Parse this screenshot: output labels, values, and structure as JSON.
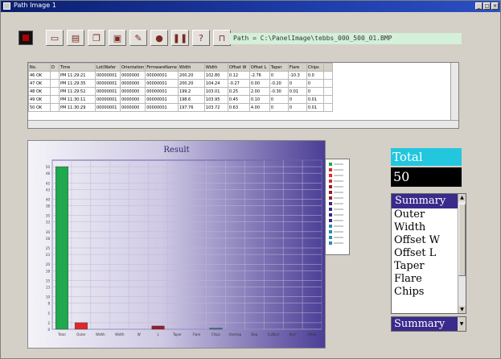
{
  "window": {
    "title": "Path Image 1",
    "controls": [
      "_",
      "□",
      "×"
    ]
  },
  "toolbar": {
    "buttons": [
      {
        "name": "new-file-button",
        "icon": "document-icon",
        "glyph": "▭"
      },
      {
        "name": "open-button",
        "icon": "open-file-icon",
        "glyph": "▤"
      },
      {
        "name": "copy-button",
        "icon": "copy-icon",
        "glyph": "❐"
      },
      {
        "name": "print-button",
        "icon": "print-icon",
        "glyph": "▣"
      },
      {
        "name": "edit-button",
        "icon": "pencil-icon",
        "glyph": "✎"
      },
      {
        "name": "record-button",
        "icon": "record-icon",
        "glyph": "●"
      },
      {
        "name": "pause-button",
        "icon": "pause-icon",
        "glyph": "❚❚"
      },
      {
        "name": "help-button",
        "icon": "help-icon",
        "glyph": "?"
      },
      {
        "name": "lock-button",
        "icon": "lock-icon",
        "glyph": "⊓"
      }
    ]
  },
  "path": {
    "text": "Path  =  C:\\PanelImage\\tebbs_000_500_01.BMP"
  },
  "grid": {
    "columns": [
      "No.",
      "D",
      "Time",
      "Lot/Wafer",
      "Orientation",
      "FirmwareName",
      "Width",
      "Width",
      "Offset W",
      "Offset L",
      "Taper",
      "Flare",
      "Chips",
      ""
    ],
    "rows": [
      {
        "no": "46 OK",
        "d": "",
        "time": "PM 11:29:21",
        "lot": "00000001",
        "ori": "0000000",
        "fw": "00000001",
        "a": "200.20",
        "b": "102.80",
        "c": "0.12",
        "d2": "-2.76",
        "e": "0",
        "f": "-10.3",
        "g": "0.0"
      },
      {
        "no": "47 OK",
        "d": "",
        "time": "PM 11:29:35",
        "lot": "00000001",
        "ori": "0000000",
        "fw": "00000001",
        "a": "200.20",
        "b": "104.24",
        "c": "-0.27",
        "d2": "0.00",
        "e": "-0.20",
        "f": "0",
        "g": "0"
      },
      {
        "no": "48 OK",
        "d": "",
        "time": "PM 11:29:52",
        "lot": "00000001",
        "ori": "0000000",
        "fw": "00000001",
        "a": "199.2",
        "b": "103.01",
        "c": "0.25",
        "d2": "2.00",
        "e": "-0.30",
        "f": "0.01",
        "g": "0"
      },
      {
        "no": "49 OK",
        "d": "",
        "time": "PM 11:30:11",
        "lot": "00000001",
        "ori": "0000000",
        "fw": "00000001",
        "a": "198.6",
        "b": "103.95",
        "c": "0.45",
        "d2": "0.10",
        "e": "0",
        "f": "0",
        "g": "0.01"
      },
      {
        "no": "50 OK",
        "d": "",
        "time": "PM 11:30:29",
        "lot": "00000001",
        "ori": "0000000",
        "fw": "00000001",
        "a": "197.76",
        "b": "103.72",
        "c": "0.63",
        "d2": "4.00",
        "e": "0",
        "f": "0",
        "g": "0.01"
      }
    ]
  },
  "chart_data": {
    "type": "bar",
    "title": "Result",
    "categories": [
      "Total",
      "Outer",
      "Width",
      "Width",
      "W",
      "L",
      "Taper",
      "Flare",
      "Chips",
      "Overlap",
      "Dep",
      "CutBurr",
      "Burr",
      "Other"
    ],
    "values": [
      50,
      2,
      0,
      0,
      0,
      1,
      0,
      0,
      0.3,
      0,
      0,
      0,
      0,
      0
    ],
    "bar_colors": [
      "#1fa84e",
      "#e0262d",
      "#e0262d",
      "#e0262d",
      "#e0262d",
      "#9b1b2a",
      "#9b1b2a",
      "#9b1b2a",
      "#1e7f8a",
      "#1e7f8a",
      "#1e7f8a",
      "#1e7f8a",
      "#1e7f8a",
      "#1e7f8a"
    ],
    "yticks": [
      0,
      2,
      5,
      8,
      10,
      13,
      15,
      18,
      20,
      23,
      25,
      28,
      30,
      33,
      35,
      38,
      40,
      43,
      45,
      48,
      50
    ],
    "ylim": [
      0,
      52
    ],
    "grid": true,
    "legend_placement": "right",
    "legend_colors": [
      "#1fa84e",
      "#e0262d",
      "#e0262d",
      "#e0262d",
      "#9b1b2a",
      "#9b1b2a",
      "#9b1b2a",
      "#2a2a8a",
      "#2a2a8a",
      "#2a2a8a",
      "#2a2a8a",
      "#2a8ab0",
      "#2a8ab0",
      "#2a8ab0",
      "#2a8ab0"
    ]
  },
  "total": {
    "label": "Total",
    "value": "50"
  },
  "summary": {
    "header": "Summary",
    "items": [
      "Outer",
      "Width",
      "Offset W",
      "Offset L",
      "Taper",
      "Flare",
      "Chips"
    ],
    "selected": "Summary"
  }
}
